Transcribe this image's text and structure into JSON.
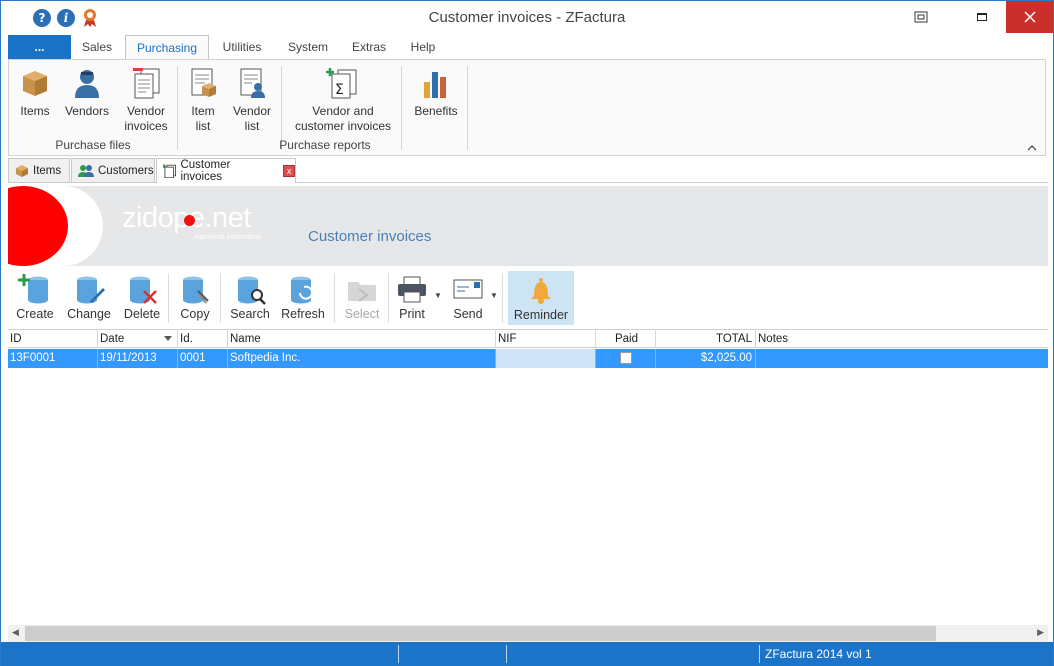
{
  "window": {
    "title": "Customer invoices - ZFactura",
    "accent_color": "#1a73c7",
    "close_color": "#c9302c"
  },
  "quick_access": [
    {
      "icon": "help-icon",
      "glyph": "?"
    },
    {
      "icon": "info-icon",
      "glyph": "i"
    },
    {
      "icon": "award-icon"
    }
  ],
  "ribbon_tabs": {
    "file": "...",
    "tabs": [
      "Sales",
      "Purchasing",
      "Utilities",
      "System",
      "Extras",
      "Help"
    ],
    "active": "Purchasing"
  },
  "ribbon": {
    "groups": [
      {
        "label": "Purchase files",
        "buttons": [
          "Items",
          "Vendors",
          "Vendor\ninvoices"
        ]
      },
      {
        "label": "Purchase reports",
        "buttons": [
          "Item\nlist",
          "Vendor\nlist",
          "Vendor and\ncustomer invoices"
        ]
      },
      {
        "label": "",
        "buttons": [
          "Benefits"
        ]
      }
    ],
    "btn": {
      "items": "Items",
      "vendors": "Vendors",
      "vendor_invoices_1": "Vendor",
      "vendor_invoices_2": "invoices",
      "item_list_1": "Item",
      "item_list_2": "list",
      "vendor_list_1": "Vendor",
      "vendor_list_2": "list",
      "vendor_customer_1": "Vendor and",
      "vendor_customer_2": "customer invoices",
      "benefits": "Benefits"
    },
    "group_purchase_files": "Purchase files",
    "group_purchase_reports": "Purchase reports",
    "collapse_glyph": "^"
  },
  "doc_tabs": {
    "items": "Items",
    "customers": "Customers",
    "customer_invoices": "Customer invoices",
    "active": "Customer invoices",
    "close_glyph": "x"
  },
  "banner": {
    "logo_text": "zidope.net",
    "logo_sub": "ingeniería informática",
    "title": "Customer invoices"
  },
  "toolbar": {
    "create": "Create",
    "change": "Change",
    "delete": "Delete",
    "copy": "Copy",
    "search": "Search",
    "refresh": "Refresh",
    "select": "Select",
    "print": "Print",
    "send": "Send",
    "reminder": "Reminder",
    "dropdown_glyph": "▼"
  },
  "grid": {
    "columns": {
      "id": "ID",
      "date": "Date",
      "idno": "Id.",
      "name": "Name",
      "nif": "NIF",
      "paid": "Paid",
      "total": "TOTAL",
      "notes": "Notes"
    },
    "rows": [
      {
        "id": "13F0001",
        "date": "19/11/2013",
        "idno": "0001",
        "name": "Softpedia Inc.",
        "nif": "",
        "paid": false,
        "total": "$2,025.00",
        "notes": ""
      }
    ]
  },
  "scrollbar": {
    "left_glyph": "◀",
    "right_glyph": "▶"
  },
  "statusbar": {
    "text": "ZFactura 2014 vol 1"
  }
}
